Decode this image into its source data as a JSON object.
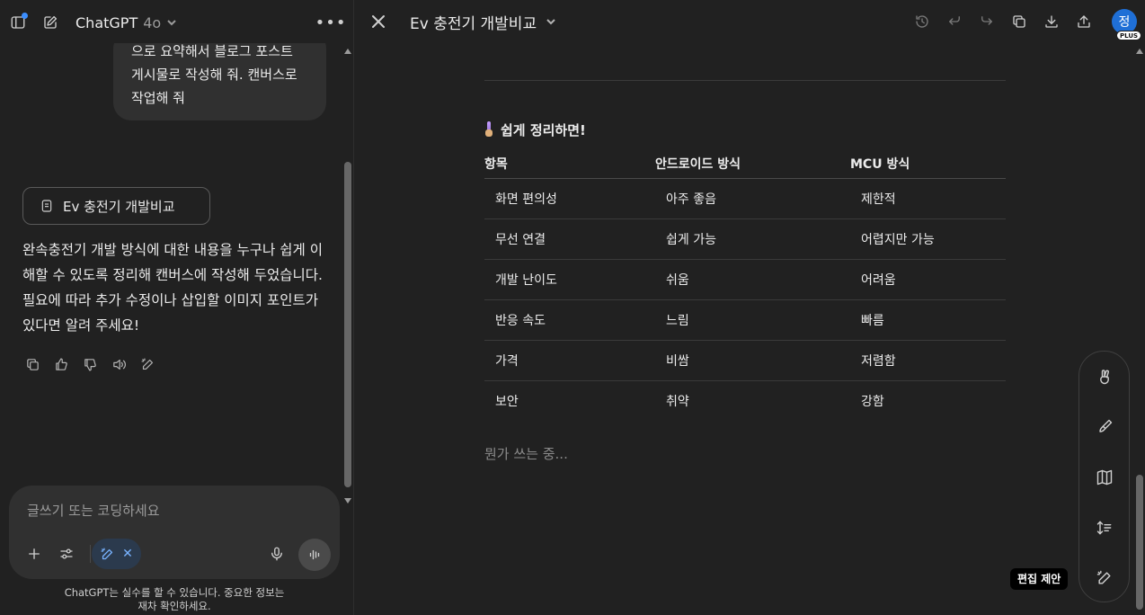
{
  "left": {
    "model": {
      "name": "ChatGPT",
      "version": "4o"
    },
    "user_message": "으로 요약해서 블로그 포스트 게시물로 작성해 줘. 캔버스로 작업해 줘",
    "canvas_chip": {
      "label": "Ev 충전기 개발비교"
    },
    "assistant_message": "완속충전기 개발 방식에 대한 내용을 누구나 쉽게 이해할 수 있도록 정리해 캔버스에 작성해 두었습니다. 필요에 따라 추가 수정이나 삽입할 이미지 포인트가 있다면 알려 주세요!",
    "composer": {
      "placeholder": "글쓰기 또는 코딩하세요"
    },
    "disclaimer_line1": "ChatGPT는 실수를 할 수 있습니다. 중요한 정보는",
    "disclaimer_line2": "재차 확인하세요."
  },
  "canvas": {
    "title": "Ev 충전기 개발비교",
    "avatar_initial": "정",
    "plan_badge": "PLUS",
    "section_heading": "쉽게 정리하면!",
    "table": {
      "headers": [
        "항목",
        "안드로이드 방식",
        "MCU 방식"
      ],
      "rows": [
        [
          "화면 편의성",
          "아주 좋음",
          "제한적"
        ],
        [
          "무선 연결",
          "쉽게 가능",
          "어렵지만 가능"
        ],
        [
          "개발 난이도",
          "쉬움",
          "어려움"
        ],
        [
          "반응 속도",
          "느림",
          "빠름"
        ],
        [
          "가격",
          "비쌈",
          "저렴함"
        ],
        [
          "보안",
          "취약",
          "강함"
        ]
      ]
    },
    "typing_indicator": "뭔가 쓰는 중...",
    "edit_tooltip": "편집 제안"
  },
  "colors": {
    "background": "#212121",
    "bubble": "#303030",
    "accent": "#1f6fd6",
    "canvas_pill": "#78b3ff"
  }
}
